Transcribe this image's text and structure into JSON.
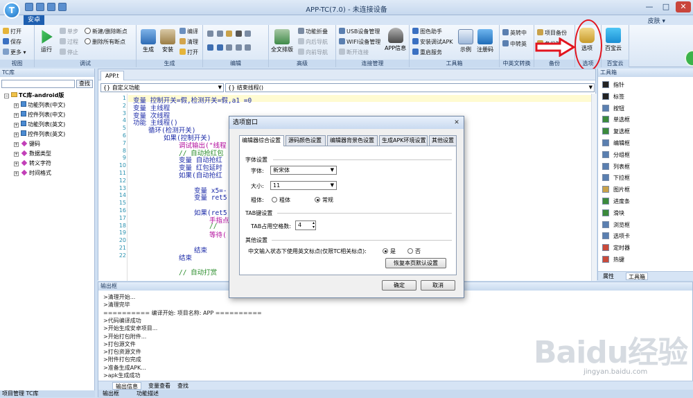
{
  "window": {
    "title": "APP-TC(7.0) - 未连接设备",
    "logo_letter": "T",
    "tab_home": "安卓",
    "skin": "皮肤 ▾",
    "minimize": "—",
    "maximize": "□",
    "close": "✕"
  },
  "ribbon": {
    "groups": [
      "视图",
      "调试",
      "生成",
      "编辑",
      "高级",
      "连接管理",
      "工具箱",
      "中英文转换",
      "备份",
      "选项",
      "百宝云"
    ],
    "view": {
      "open": "打开",
      "save": "保存",
      "more": "更多 ▾"
    },
    "debug": {
      "run": "运行",
      "step": "单步",
      "pass": "过程",
      "stop": "停止",
      "toggle_breakpoint": "新建/删除断点",
      "clear_breakpoints": "删除所有断点"
    },
    "build": {
      "generate": "生成",
      "install": "安装",
      "compile": "编译",
      "clean": "清理",
      "open": "打开"
    },
    "advanced": {
      "full_sort": "全文排版",
      "fold": "功能折叠",
      "nav_back": "向后导航",
      "nav_forward": "向前导航"
    },
    "connect": {
      "usb": "USB设备管理",
      "wifi": "WIFI设备管理",
      "disconnect": "断开连接",
      "app_info": "APP信息"
    },
    "tools": {
      "color_helper": "图色助手",
      "install_debug_apk": "安装调试APK",
      "restart_service": "重启服务",
      "example": "示例",
      "register": "注册码"
    },
    "lang": {
      "en_to_cn": "英转中",
      "cn_to_en": "中转英"
    },
    "backup": {
      "project_backup": "项目备份",
      "backup_manage": "备份管理"
    },
    "options": {
      "label": "选项"
    },
    "baibao": {
      "label": "百宝云"
    }
  },
  "library": {
    "title": "TC库",
    "search_button": "查找",
    "root": "TC库-android版",
    "items": [
      "功能列表(中文)",
      "控件列表(中文)",
      "功能列表(英文)",
      "控件列表(英文)",
      "键码",
      "数据类型",
      "转义字符",
      "时间格式"
    ],
    "bottom_tabs": "项目管理  TC库"
  },
  "editor": {
    "file_tab": "APP.t",
    "func_combo": "{} 自定义功能",
    "thread_combo": "{} 结束线程()",
    "line_numbers": [
      "1",
      "2",
      "3",
      "4",
      "5",
      "6",
      "7",
      "8",
      "9",
      "10",
      "11",
      "12",
      "13",
      "14",
      "15",
      "16",
      "17",
      "18",
      "19",
      "20",
      "21",
      "22"
    ],
    "lines": [
      {
        "text": "",
        "color": "#000"
      },
      {
        "text": "变量 控制开关=假,检测开关=假,a1 =0",
        "color": "#1c2ba8"
      },
      {
        "text": "变量 主线程",
        "color": "#1c2ba8"
      },
      {
        "text": "变量 次线程",
        "color": "#1c2ba8"
      },
      {
        "text": "功能 主线程()",
        "color": "#1c2ba8"
      },
      {
        "text": "循环(检测开关)",
        "color": "#1c2ba8"
      },
      {
        "text": "如果(控制开关)",
        "color": "#1c2ba8"
      },
      {
        "text": "调试输出(\"线程",
        "color": "#b10a9c"
      },
      {
        "text": "// 自动抢红包",
        "color": "#2a8c2a"
      },
      {
        "text": "变量 自动抢红",
        "color": "#1c2ba8"
      },
      {
        "text": "变量 红包延时",
        "color": "#1c2ba8"
      },
      {
        "text": "如果(自动抢红",
        "color": "#1c2ba8"
      },
      {
        "text": "",
        "color": "#000"
      },
      {
        "text": "变量 x5=-",
        "color": "#1c2ba8"
      },
      {
        "text": "变量 ret5",
        "color": "#1c2ba8"
      },
      {
        "text": "",
        "color": "#000"
      },
      {
        "text": "如果(ret5",
        "color": "#1c2ba8"
      },
      {
        "text": "手指点",
        "color": "#b10a9c"
      },
      {
        "text": "//",
        "color": "#2a8c2a"
      },
      {
        "text": "等待(",
        "color": "#b10a9c"
      },
      {
        "text": "",
        "color": "#000"
      },
      {
        "text": "结束",
        "color": "#1c2ba8"
      },
      {
        "text": "结束",
        "color": "#1c2ba8"
      },
      {
        "text": "",
        "color": "#000"
      },
      {
        "text": "// 自动打赏",
        "color": "#2a8c2a"
      }
    ]
  },
  "toolbox": {
    "title": "工具箱",
    "items": [
      "指针",
      "标签",
      "按钮",
      "单选框",
      "复选框",
      "编辑框",
      "分组框",
      "列表框",
      "下拉框",
      "图片框",
      "进度条",
      "滑块",
      "浏览框",
      "选项卡",
      "定时器",
      "热键"
    ],
    "tab_props": "属性",
    "tab_toolbox": "工具箱"
  },
  "output": {
    "title": "输出框",
    "lines": [
      ">清理开始...",
      ">清理完毕",
      "========== 编译开始: 项目名称: APP ==========",
      ">代码编译成功",
      ">开始生成安卓项目...",
      ">开始打包附件...",
      ">打包源文件",
      ">打包资源文件",
      ">附件打包完成",
      ">准备生成APK...",
      ">apk生成成功"
    ],
    "tabs": [
      "输出信息",
      "变量查看",
      "查找"
    ],
    "status": [
      "输出框",
      "功能描述"
    ]
  },
  "dialog": {
    "title": "选项窗口",
    "close": "✕",
    "tabs": [
      "编辑器综合设置",
      "源码颜色设置",
      "编辑器背景色设置",
      "生成APK环境设置",
      "其他设置"
    ],
    "font_section": "字体设置",
    "font_label": "字体:",
    "font_value": "新宋体",
    "size_label": "大小:",
    "size_value": "11",
    "bold_label": "粗体:",
    "bold_option": "粗体",
    "regular_option": "常规",
    "tab_section": "TAB键设置",
    "tab_spaces_label": "TAB占用空格数:",
    "tab_spaces_value": "4",
    "other_section": "其他设置",
    "cn_punct_label": "中文输入状态下使用英文标点(仅限TC相关标点):",
    "yes": "是",
    "no": "否",
    "restore_button": "恢复本页默认设置",
    "ok_button": "确定",
    "cancel_button": "取消"
  },
  "watermark": {
    "brand": "Baidu经验",
    "url": "jingyan.baidu.com"
  },
  "colors": {
    "accent": "#1e5fb0",
    "highlight_red": "#e2141e",
    "ribbon_bg": "#d9e6f5"
  }
}
